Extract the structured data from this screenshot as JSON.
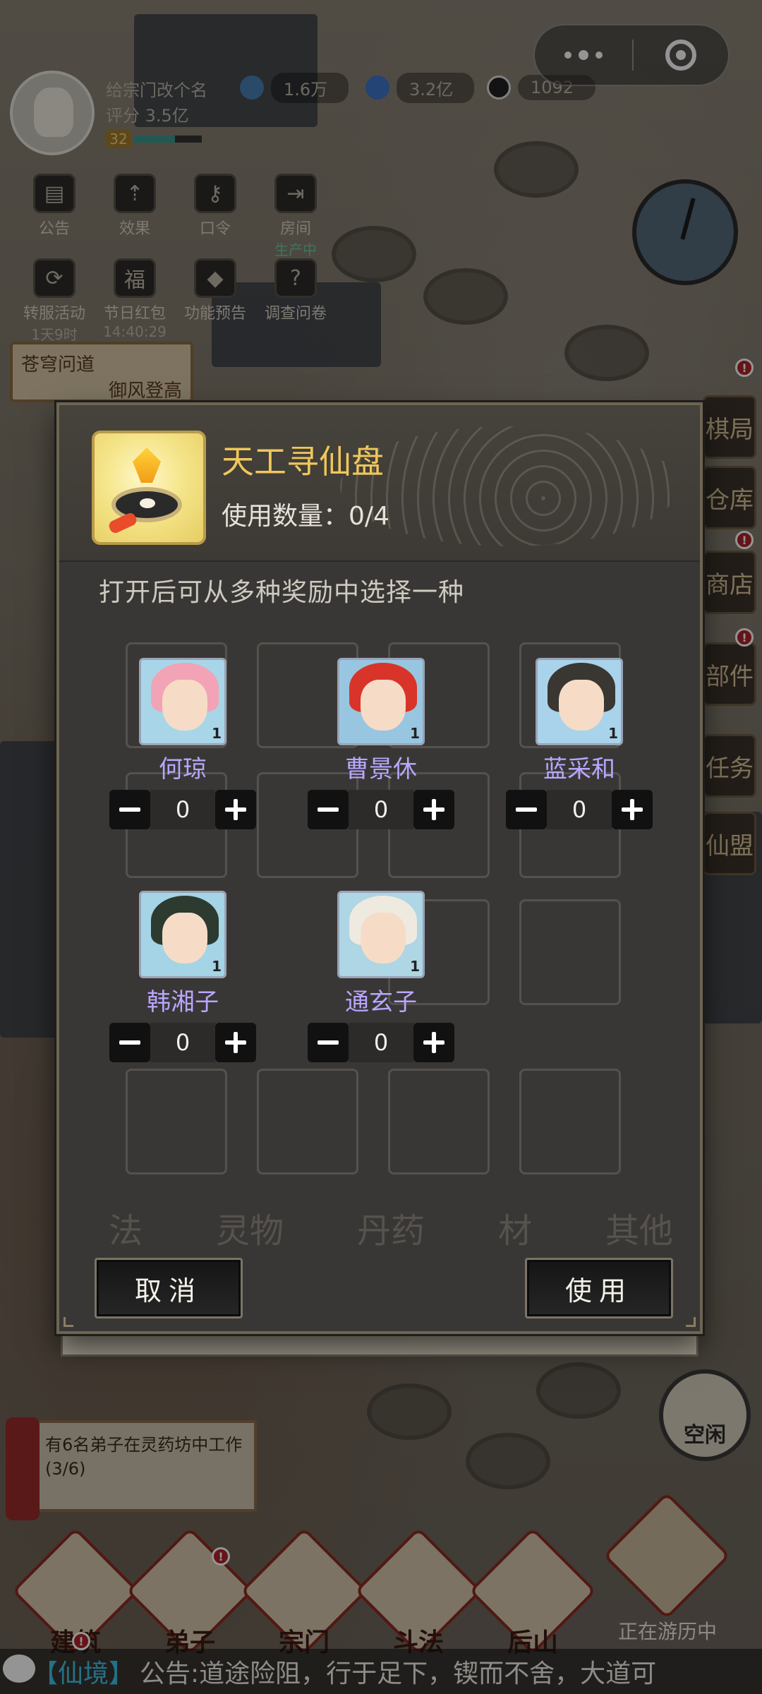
{
  "header": {
    "player_name": "给宗门改个名",
    "score": "评分 3.5亿",
    "level": "32",
    "resources": [
      {
        "name": "spirit-stone",
        "value": "1.6万"
      },
      {
        "name": "spirit-jade",
        "value": "3.2亿"
      },
      {
        "name": "taiji-coin",
        "value": "1092"
      }
    ]
  },
  "tools": [
    {
      "label": "公告",
      "icon": "notice-icon"
    },
    {
      "label": "效果",
      "icon": "effect-icon"
    },
    {
      "label": "口令",
      "icon": "key-icon"
    },
    {
      "label": "房间",
      "icon": "door-icon",
      "sub": "生产中"
    },
    {
      "label": "转服活动",
      "icon": "transfer-icon",
      "sub": "1天9时"
    },
    {
      "label": "节日红包",
      "icon": "redpacket-icon",
      "sub": "14:40:29"
    },
    {
      "label": "功能预告",
      "icon": "preview-icon"
    },
    {
      "label": "调查问卷",
      "icon": "survey-icon"
    }
  ],
  "left_banner": {
    "line1": "苍穹问道",
    "line2": "御风登高"
  },
  "right_labels": [
    "棋局",
    "仓库",
    "商店",
    "部件",
    "任务",
    "仙盟"
  ],
  "modal": {
    "item_name": "天工寻仙盘",
    "usage": "使用数量：0/4",
    "description": "打开后可从多种奖励中选择一种",
    "options": [
      {
        "name": "何琼",
        "count": "0",
        "level": "1"
      },
      {
        "name": "曹景休",
        "count": "0",
        "level": "1"
      },
      {
        "name": "蓝采和",
        "count": "0",
        "level": "1"
      },
      {
        "name": "韩湘子",
        "count": "0",
        "level": "1"
      },
      {
        "name": "通玄子",
        "count": "0",
        "level": "1"
      }
    ],
    "categories": [
      "法",
      "灵物",
      "丹药",
      "材",
      "其他"
    ],
    "cancel_label": "取消",
    "use_label": "使用"
  },
  "notice": "有6名弟子在灵药坊中工作(3/6)",
  "nav": [
    "建筑",
    "弟子",
    "宗门",
    "斗法",
    "后山"
  ],
  "travel_status": "正在游历中",
  "gourd_label": "空闲",
  "chat": {
    "tag": "【仙境】",
    "message": "公告:道途险阻，行于足下，锲而不舍，大道可"
  }
}
